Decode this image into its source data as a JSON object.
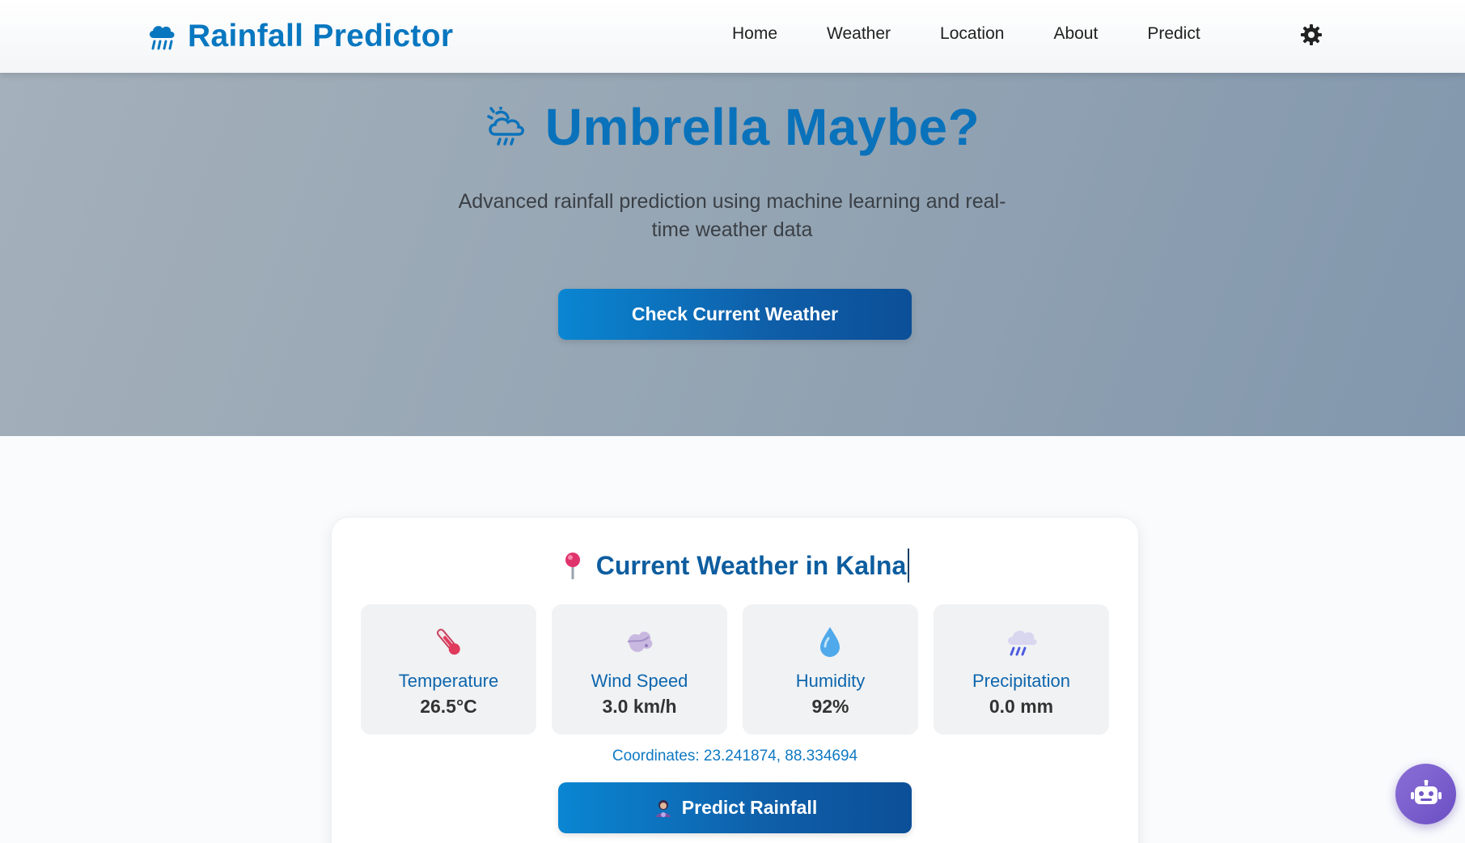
{
  "app": {
    "title": "Rainfall Predictor",
    "brand_color": "#0877c0"
  },
  "nav": {
    "items": [
      {
        "label": "Home"
      },
      {
        "label": "Weather"
      },
      {
        "label": "Location"
      },
      {
        "label": "About"
      },
      {
        "label": "Predict"
      }
    ],
    "theme_toggle_icon": "gear-icon"
  },
  "hero": {
    "title": "Umbrella Maybe?",
    "title_icon": "cloud-rain-sun-icon",
    "subtitle": "Advanced rainfall prediction using machine learning and real-time weather data",
    "cta_label": "Check Current Weather"
  },
  "weather": {
    "title": "Current Weather in Kalna",
    "title_icon": "map-pin-icon",
    "stats": [
      {
        "icon": "thermometer-icon",
        "label": "Temperature",
        "value": "26.5°C"
      },
      {
        "icon": "wind-icon",
        "label": "Wind Speed",
        "value": "3.0 km/h"
      },
      {
        "icon": "droplet-icon",
        "label": "Humidity",
        "value": "92%"
      },
      {
        "icon": "rain-cloud-icon",
        "label": "Precipitation",
        "value": "0.0 mm"
      }
    ],
    "coordinates": "Coordinates: 23.241874, 88.334694",
    "predict_label": "Predict Rainfall",
    "predict_icon": "fortune-teller-icon"
  },
  "chatbot": {
    "icon": "robot-icon",
    "color": "#7b5fd0"
  },
  "colors": {
    "primary": "#0a72bb",
    "button_start": "#0a86d2",
    "button_end": "#0b4f98",
    "hero_bg": "#96a6b4"
  }
}
